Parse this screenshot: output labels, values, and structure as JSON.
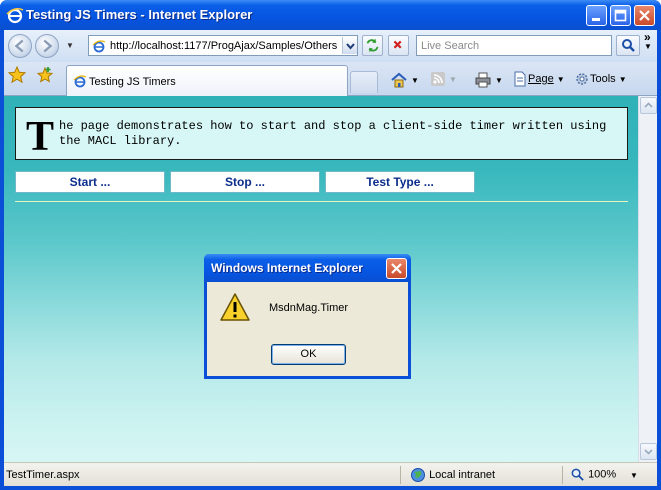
{
  "window": {
    "title": "Testing JS Timers - Internet Explorer"
  },
  "addressbar": {
    "url": "http://localhost:1177/ProgAjax/Samples/Others",
    "search_placeholder": "Live Search"
  },
  "tabs": [
    {
      "label": "Testing JS Timers"
    }
  ],
  "commandbar": {
    "page_label": "Page",
    "tools_label": "Tools",
    "more_label": "»"
  },
  "page": {
    "intro_dropcap": "T",
    "intro_text": "he page demonstrates how to start and stop a client-side timer written using the MACL library.",
    "buttons": {
      "start": "Start ...",
      "stop": "Stop ...",
      "test_type": "Test Type ..."
    }
  },
  "dialog": {
    "title": "Windows Internet Explorer",
    "message": "MsdnMag.Timer",
    "ok_label": "OK"
  },
  "statusbar": {
    "text": "TestTimer.aspx",
    "zone": "Local intranet",
    "zoom": "100%"
  }
}
